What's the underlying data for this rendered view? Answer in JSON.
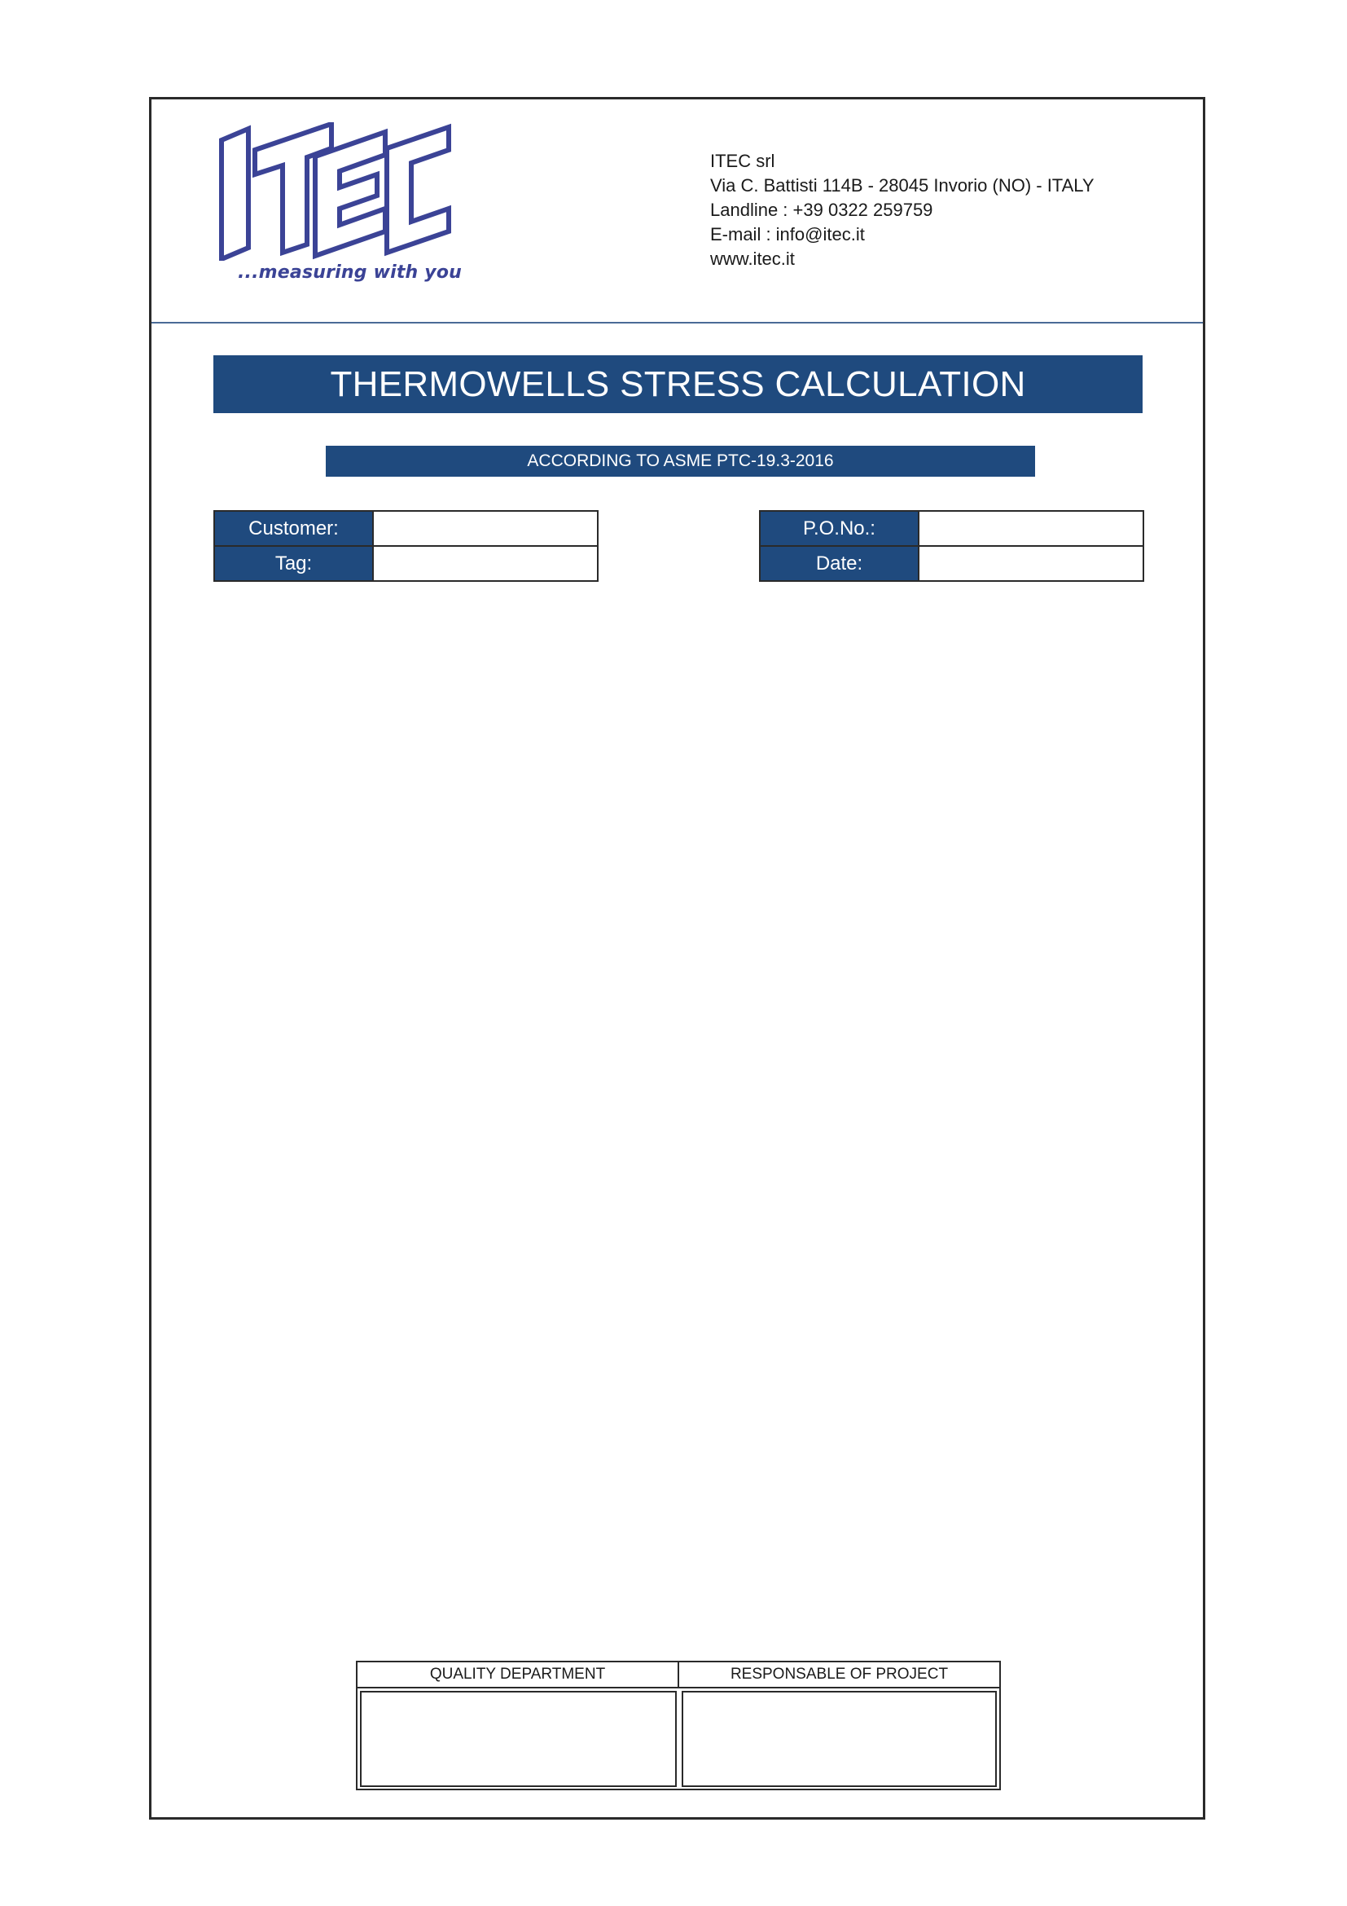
{
  "logo": {
    "wordmark": "ITEC",
    "tagline": "...measuring with you",
    "color": "#3b4396"
  },
  "company": {
    "name": "ITEC srl",
    "address": "Via C. Battisti 114B - 28045 Invorio (NO) - ITALY",
    "landline": "Landline : +39 0322 259759",
    "email": "E-mail : info@itec.it",
    "website": "www.itec.it"
  },
  "document": {
    "title": "THERMOWELLS STRESS CALCULATION",
    "subtitle": "ACCORDING TO ASME PTC-19.3-2016"
  },
  "fields": {
    "customer": {
      "label": "Customer:",
      "value": ""
    },
    "tag": {
      "label": "Tag:",
      "value": ""
    },
    "po_no": {
      "label": "P.O.No.:",
      "value": ""
    },
    "date": {
      "label": "Date:",
      "value": ""
    }
  },
  "signatures": {
    "quality": "QUALITY DEPARTMENT",
    "project": "RESPONSABLE OF PROJECT"
  },
  "colors": {
    "accent": "#1f4a7e",
    "logo": "#3b4396",
    "frame": "#2a2a2a"
  }
}
